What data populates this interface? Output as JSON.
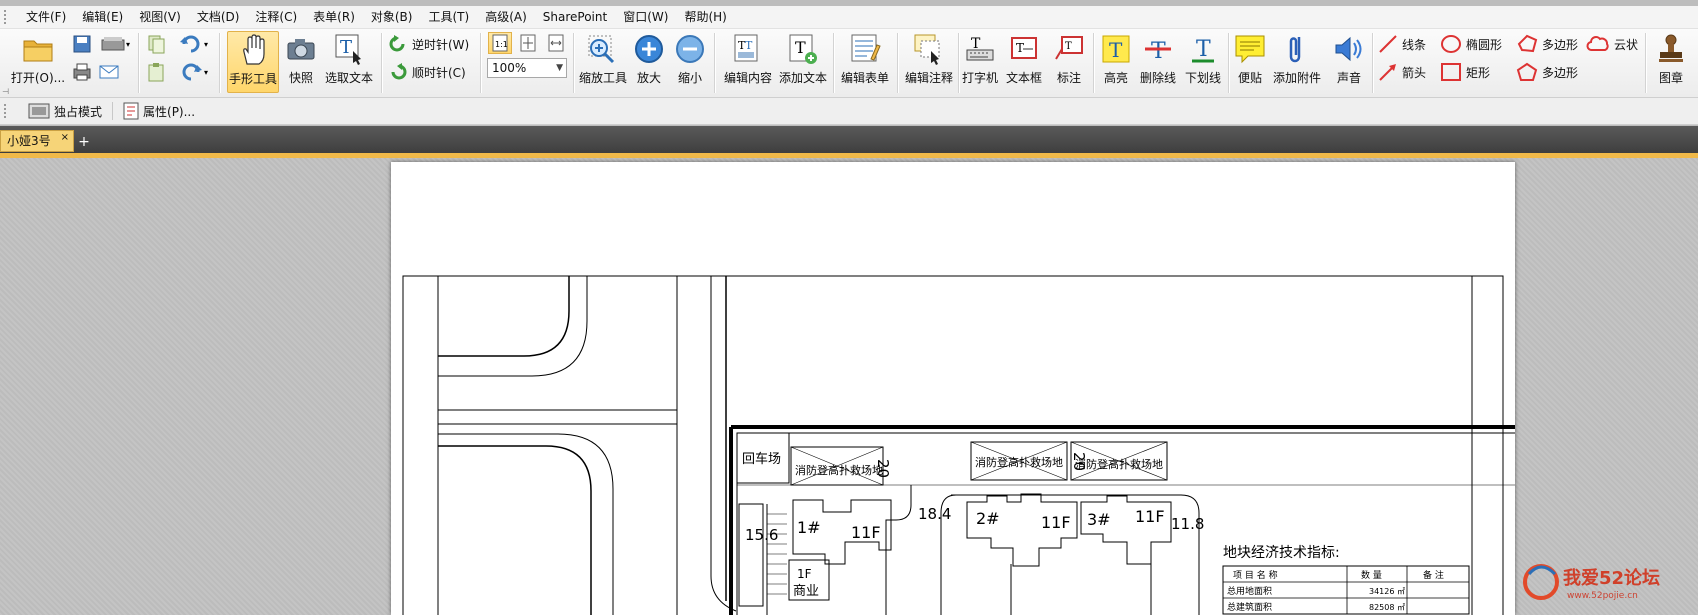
{
  "menu": [
    "文件(F)",
    "编辑(E)",
    "视图(V)",
    "文档(D)",
    "注释(C)",
    "表单(R)",
    "对象(B)",
    "工具(T)",
    "高级(A)",
    "SharePoint",
    "窗口(W)",
    "帮助(H)"
  ],
  "toolbar": {
    "open": "打开(O)...",
    "hand_tool": "手形工具",
    "snapshot": "快照",
    "select_text": "选取文本",
    "rotate_ccw": "逆时针(W)",
    "rotate_cw": "顺时针(C)",
    "zoom_value": "100%",
    "zoom_tool": "缩放工具",
    "zoom_in": "放大",
    "zoom_out": "缩小",
    "edit_content": "编辑内容",
    "add_text": "添加文本",
    "edit_form": "编辑表单",
    "edit_annotation": "编辑注释",
    "typewriter": "打字机",
    "textbox": "文本框",
    "callout": "标注",
    "highlight": "高亮",
    "strikeout": "删除线",
    "underline": "下划线",
    "note": "便贴",
    "attach": "添加附件",
    "sound": "声音",
    "line": "线条",
    "ellipse": "椭圆形",
    "polygon1": "多边形",
    "cloud": "云状",
    "arrow": "箭头",
    "rectangle": "矩形",
    "polygon2": "多边形",
    "stamp": "图章"
  },
  "toolbar2": {
    "exclusive_mode": "独占模式",
    "properties": "属性(P)..."
  },
  "tab": {
    "title": "小娅3号",
    "close": "×",
    "new": "+"
  },
  "drawing": {
    "label_turnaround": "回车场",
    "fire_area_1": "消防登高扑救场地",
    "fire_area_2": "消防登高扑救场地",
    "fire_area_3": "消防登高扑救场地",
    "dim_20_1": "20",
    "dim_20_2": "20",
    "dim_15_6": "15.6",
    "dim_18_4": "18.4",
    "dim_11_8": "11.8",
    "bldg1": "1#",
    "bldg1_floors": "11F",
    "bldg2": "2#",
    "bldg2_floors": "11F",
    "bldg3": "3#",
    "bldg3_floors": "11F",
    "commercial_floors": "1F",
    "commercial": "商业",
    "table_title": "地块经济技术指标:",
    "table_headers": [
      "项 目 名 称",
      "数 量",
      "备 注"
    ],
    "table_rows": [
      [
        "总用地面积",
        "34126 ㎡",
        ""
      ],
      [
        "总建筑面积",
        "82508 ㎡",
        ""
      ]
    ]
  },
  "watermark": {
    "text": "我爱52论坛",
    "url": "www.52pojie.cn"
  }
}
